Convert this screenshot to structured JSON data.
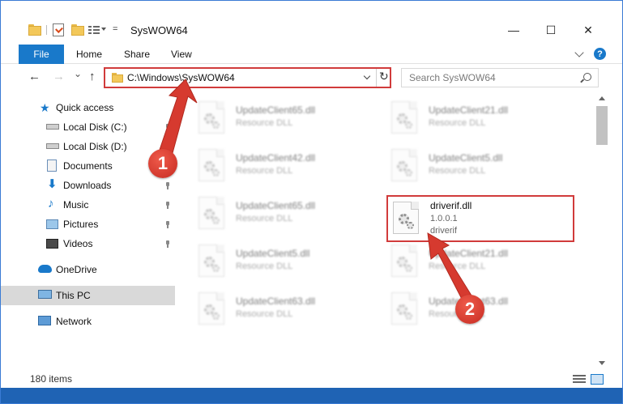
{
  "window": {
    "title": "SysWOW64",
    "qat_dropdown": "=",
    "min_label": "—",
    "max_label": "☐",
    "close_label": "✕"
  },
  "ribbon": {
    "tabs": [
      "File",
      "Home",
      "Share",
      "View"
    ],
    "help": "?"
  },
  "nav": {
    "back": "←",
    "forward": "→",
    "recent": "⌄",
    "up": "↑",
    "address": "C:\\Windows\\SysWOW64",
    "refresh": "↻",
    "search_placeholder": "Search SysWOW64"
  },
  "sidebar": {
    "items": [
      {
        "label": "Quick access",
        "icon": "star-icon"
      },
      {
        "label": "Local Disk (C:)",
        "icon": "drive-icon"
      },
      {
        "label": "Local Disk (D:)",
        "icon": "drive-icon"
      },
      {
        "label": "Documents",
        "icon": "documents-icon"
      },
      {
        "label": "Downloads",
        "icon": "downloads-icon"
      },
      {
        "label": "Music",
        "icon": "music-icon"
      },
      {
        "label": "Pictures",
        "icon": "pictures-icon"
      },
      {
        "label": "Videos",
        "icon": "videos-icon"
      },
      {
        "label": "OneDrive",
        "icon": "cloud-icon"
      },
      {
        "label": "This PC",
        "icon": "computer-icon"
      },
      {
        "label": "Network",
        "icon": "network-icon"
      }
    ],
    "selected": "This PC"
  },
  "files": [
    {
      "name": "UpdateClient65.dll",
      "sub": "Resource DLL"
    },
    {
      "name": "UpdateClient21.dll",
      "sub": "Resource DLL"
    },
    {
      "name": "UpdateClient42.dll",
      "sub": "Resource DLL"
    },
    {
      "name": "UpdateClient5.dll",
      "sub": "Resource DLL"
    },
    {
      "name": "UpdateClient65.dll",
      "sub": "Resource DLL"
    },
    {
      "name": "driverif.dll",
      "sub": "1.0.0.1",
      "sub2": "driverif",
      "highlighted": true
    },
    {
      "name": "UpdateClient5.dll",
      "sub": "Resource DLL"
    },
    {
      "name": "UpdateClient21.dll",
      "sub": "Resource DLL"
    },
    {
      "name": "UpdateClient63.dll",
      "sub": "Resource DLL"
    },
    {
      "name": "UpdateClient63.dll",
      "sub": "Resource DLL"
    }
  ],
  "status": {
    "item_count": "180 items"
  },
  "annotations": {
    "step1": "1",
    "step2": "2",
    "highlight_color": "#d13b3b"
  },
  "colors": {
    "accent": "#1979ca",
    "selection": "#d9d9d9",
    "marker": "#d63a2f"
  }
}
